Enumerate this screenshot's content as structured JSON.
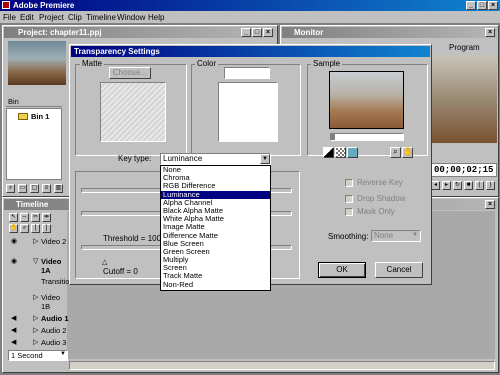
{
  "app": {
    "title": "Adobe Premiere",
    "menu": [
      "File",
      "Edit",
      "Project",
      "Clip",
      "Timeline",
      "Window",
      "Help"
    ]
  },
  "project_window": {
    "title": "Project: chapter11.ppj",
    "bin_header": "Bin",
    "bin_item": "Bin 1"
  },
  "monitor_window": {
    "title": "Monitor",
    "program_label": "Program",
    "timecode": "00;00;02;15"
  },
  "timeline_window": {
    "title": "Timeline",
    "tracks": [
      "Video 2",
      "Video 1A",
      "Transition",
      "Video 1B",
      "Audio 1",
      "Audio 2",
      "Audio 3"
    ],
    "zoom_value": "1 Second"
  },
  "dialog": {
    "title": "Transparency Settings",
    "matte_label": "Matte",
    "choose_button": "Choose...",
    "color_label": "Color",
    "sample_label": "Sample",
    "key_type_label": "Key type:",
    "key_type_value": "Luminance",
    "key_type_options": [
      "None",
      "Chroma",
      "RGB Difference",
      "Luminance",
      "Alpha Channel",
      "Black Alpha Matte",
      "White Alpha Matte",
      "Image Matte",
      "Difference Matte",
      "Blue Screen",
      "Green Screen",
      "Multiply",
      "Screen",
      "Track Matte",
      "Non-Red"
    ],
    "selected_index": 3,
    "threshold_label": "Threshold = 100",
    "cutoff_label": "Cutoff = 0",
    "reverse_key_label": "Reverse Key",
    "drop_shadow_label": "Drop Shadow",
    "mask_only_label": "Mask Only",
    "smoothing_label": "Smoothing:",
    "smoothing_value": "None",
    "ok_label": "OK",
    "cancel_label": "Cancel"
  },
  "colors": {
    "title_active": "#000080",
    "face": "#c0c0c0",
    "desktop": "#7f7f7f",
    "highlight": "#000080"
  }
}
